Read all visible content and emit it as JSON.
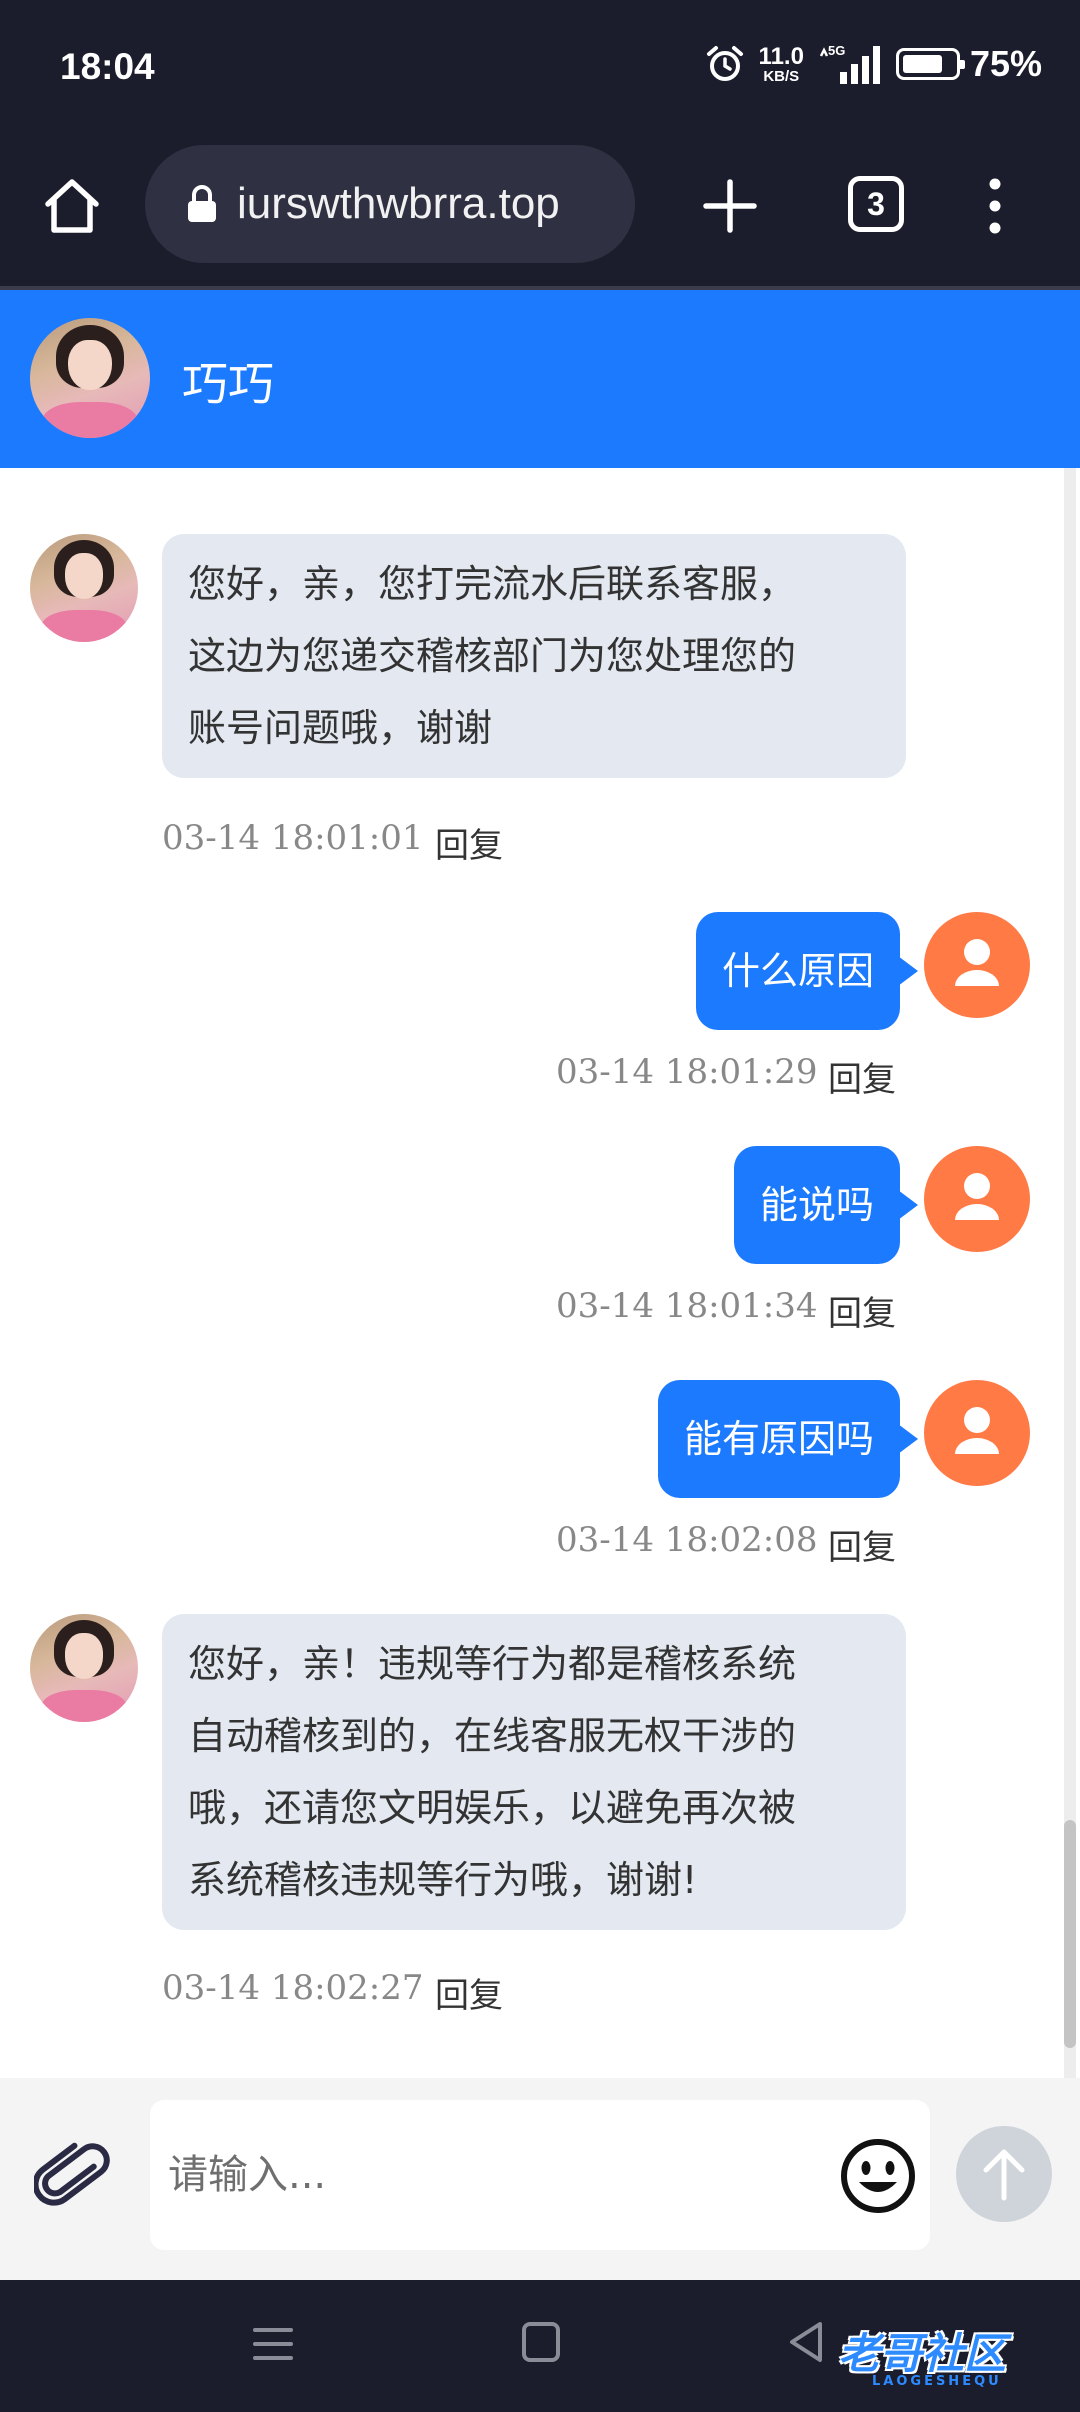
{
  "status_bar": {
    "time": "18:04",
    "net_speed_value": "11.0",
    "net_speed_unit": "KB/S",
    "network_type": "5G",
    "battery_pct": "75%",
    "battery_level": 0.75
  },
  "browser": {
    "url": "iurswthwbrra.top",
    "tab_count": "3"
  },
  "chat": {
    "contact_name": "巧巧",
    "messages": [
      {
        "side": "agent",
        "text_lines": [
          "您好，亲，您打完流水后联系客服，",
          "这边为您递交稽核部门为您处理您的",
          "账号问题哦，谢谢"
        ],
        "time": "03-14 18:01:01",
        "reply": "回复"
      },
      {
        "side": "user",
        "text": "什么原因",
        "time": "03-14 18:01:29",
        "reply": "回复"
      },
      {
        "side": "user",
        "text": "能说吗",
        "time": "03-14 18:01:34",
        "reply": "回复"
      },
      {
        "side": "user",
        "text": "能有原因吗",
        "time": "03-14 18:02:08",
        "reply": "回复"
      },
      {
        "side": "agent",
        "text_lines": [
          "您好，亲！违规等行为都是稽核系统",
          "自动稽核到的，在线客服无权干涉的",
          "哦，还请您文明娱乐，以避免再次被",
          "系统稽核违规等行为哦，谢谢!"
        ],
        "time": "03-14 18:02:27",
        "reply": "回复"
      }
    ]
  },
  "input": {
    "placeholder": "请输入..."
  },
  "watermark": {
    "text": "老哥社区",
    "sub": "LAOGESHEQU"
  },
  "colors": {
    "header_blue": "#1c7aff",
    "user_bubble": "#1c7aff",
    "agent_bubble": "#e3e8f1",
    "user_avatar": "#ff7a45",
    "system_bar": "#1c1d2c"
  }
}
